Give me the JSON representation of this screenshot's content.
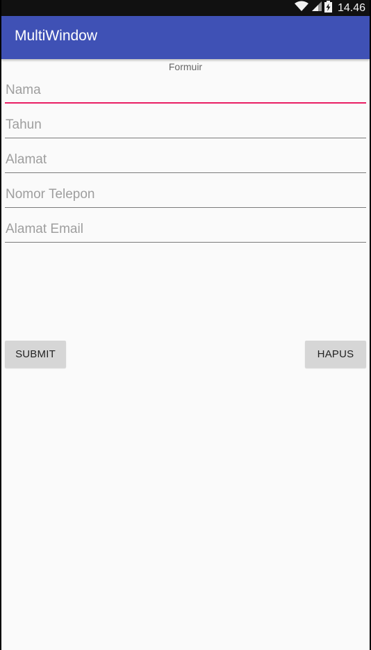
{
  "status_bar": {
    "time": "14.46",
    "icons": [
      "wifi-icon",
      "signal-icon",
      "battery-charging-icon"
    ]
  },
  "app_bar": {
    "title": "MultiWindow"
  },
  "form": {
    "heading": "Formuir",
    "fields": [
      {
        "placeholder": "Nama",
        "value": "",
        "focused": true
      },
      {
        "placeholder": "Tahun",
        "value": "",
        "focused": false
      },
      {
        "placeholder": "Alamat",
        "value": "",
        "focused": false
      },
      {
        "placeholder": "Nomor Telepon",
        "value": "",
        "focused": false
      },
      {
        "placeholder": "Alamat Email",
        "value": "",
        "focused": false
      }
    ],
    "submit_label": "SUBMIT",
    "clear_label": "HAPUS"
  },
  "colors": {
    "primary": "#3f51b5",
    "accent": "#e91e63",
    "background": "#fafafa",
    "button": "#d6d6d6"
  }
}
